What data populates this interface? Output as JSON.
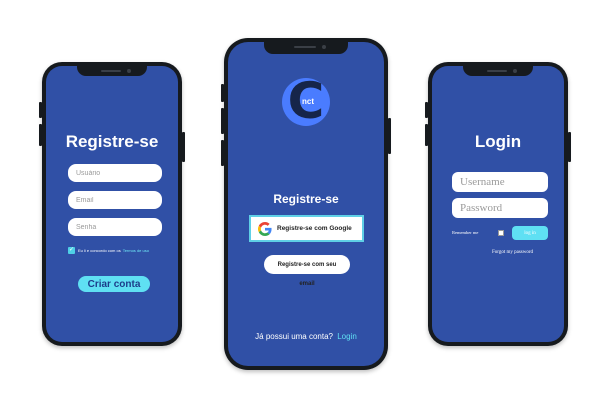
{
  "signup_form": {
    "title": "Registre-se",
    "username_placeholder": "Usuário",
    "email_placeholder": "Email",
    "password_placeholder": "Senha",
    "terms_text": "Eu li e concordo com os",
    "terms_link": "Termos de uso",
    "terms_checked": true,
    "create_button": "Criar conta"
  },
  "signup_social": {
    "logo_letter": "C",
    "logo_text": "nct",
    "title": "Registre-se",
    "google_button": "Registre-se com Google",
    "email_button": "Registre-se com seu email",
    "footer_question": "Já possui uma conta?",
    "footer_link": "Login"
  },
  "login_form": {
    "title": "Login",
    "username_placeholder": "Username",
    "password_placeholder": "Password",
    "remember_label": "Remember me",
    "login_button": "log in",
    "forgot_link": "Forgot my password"
  },
  "colors": {
    "screen": "#3050a6",
    "accent": "#5fe0f3",
    "frame": "#161a1e",
    "logo": "#4a7cff"
  }
}
